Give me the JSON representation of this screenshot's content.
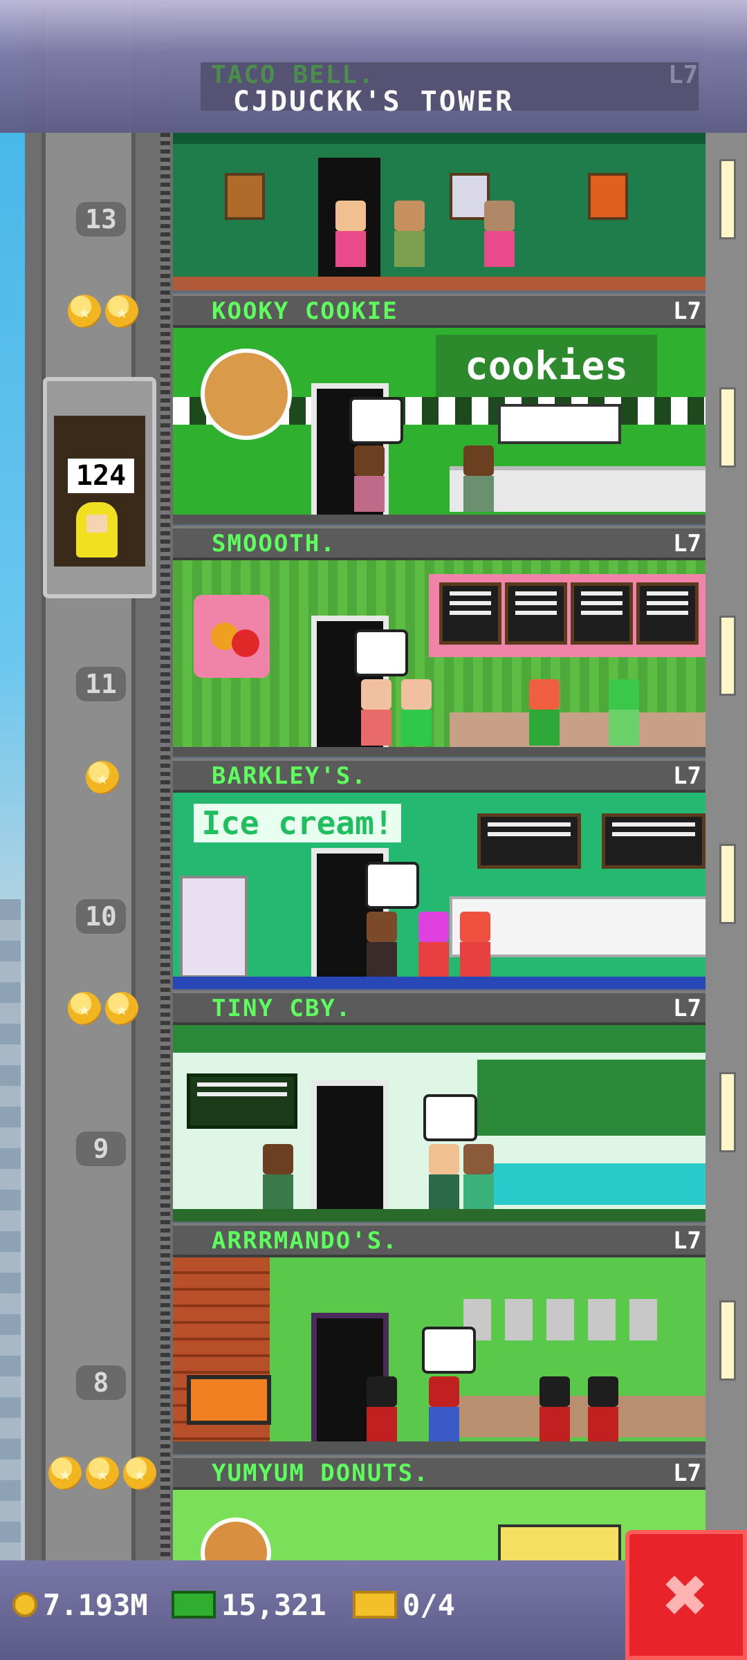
{
  "header": {
    "title": "CJDUCKK'S TOWER",
    "prev_floor_name": "TACO BELL.",
    "prev_floor_level": "L7"
  },
  "elevator": {
    "count": "124"
  },
  "shaft_floor_numbers": [
    "13",
    "11",
    "10",
    "9",
    "8"
  ],
  "floors": [
    {
      "name": "KOOKY COOKIE",
      "level": "L7",
      "sign": "cookies"
    },
    {
      "name": "SMOOOTH.",
      "level": "L7"
    },
    {
      "name": "BARKLEY'S.",
      "level": "L7",
      "sign": "Ice cream!"
    },
    {
      "name": "TINY CBY.",
      "level": "L7"
    },
    {
      "name": "ARRRMANDO'S.",
      "level": "L7"
    },
    {
      "name": "YUMYUM DONUTS.",
      "level": "L7"
    }
  ],
  "stats": {
    "coins": "7.193M",
    "bux": "15,321",
    "vip": "0/4"
  },
  "close_button": {
    "glyph": "✖"
  },
  "colors": {
    "floor_label": "#5cff5c",
    "header_bg": "#7d7aa6",
    "close_red": "#e8242a"
  }
}
